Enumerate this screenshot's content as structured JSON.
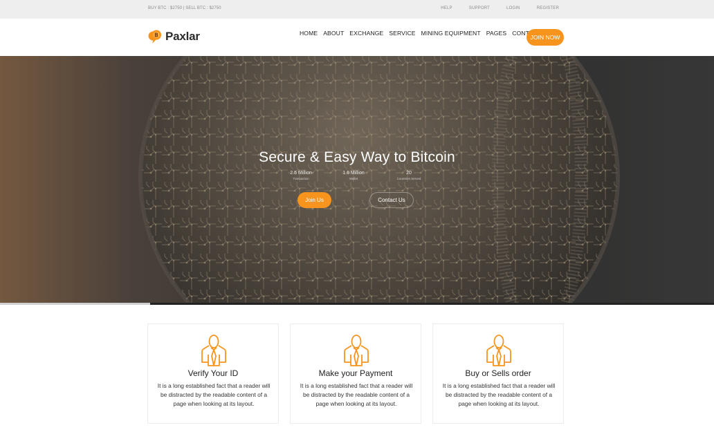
{
  "topbar": {
    "rates": "BUY BTC : $2750 | SELL BTC : $2750",
    "links": [
      "HELP",
      "SUPPORT",
      "LOGIN",
      "REGISTER"
    ]
  },
  "header": {
    "logo_text": "Paxlar",
    "logo_icon": "bitcoin-bubble-icon",
    "nav": [
      "HOME",
      "ABOUT",
      "EXCHANGE",
      "SERVICE",
      "MINING EQUIPMENT",
      "PAGES",
      "CONTACT"
    ],
    "cta": "JOIN NOW"
  },
  "hero": {
    "title": "Secure & Easy Way to Bitcoin",
    "stats": [
      {
        "num": "2.5 Million",
        "label": "Transaction"
      },
      {
        "num": "1.6 Million",
        "label": "Wallet"
      },
      {
        "num": "20",
        "label": "Countries Served"
      }
    ],
    "primary_button": "Join Us",
    "secondary_button": "Contact Us",
    "slider_progress": 0.21
  },
  "cards": [
    {
      "title": "Verify Your ID",
      "text": "It is a long established fact that a reader will be distracted by the readable content of a page when looking at its layout.",
      "icon": "person-tie-icon"
    },
    {
      "title": "Make your Payment",
      "text": "It is a long established fact that a reader will be distracted by the readable content of a page when looking at its layout.",
      "icon": "person-tie-icon"
    },
    {
      "title": "Buy or Sells order",
      "text": "It is a long established fact that a reader will be distracted by the readable content of a page when looking at its layout.",
      "icon": "person-tie-icon"
    }
  ],
  "colors": {
    "accent": "#f7941d",
    "topbar_bg": "#eeeeee",
    "text": "#222222"
  }
}
